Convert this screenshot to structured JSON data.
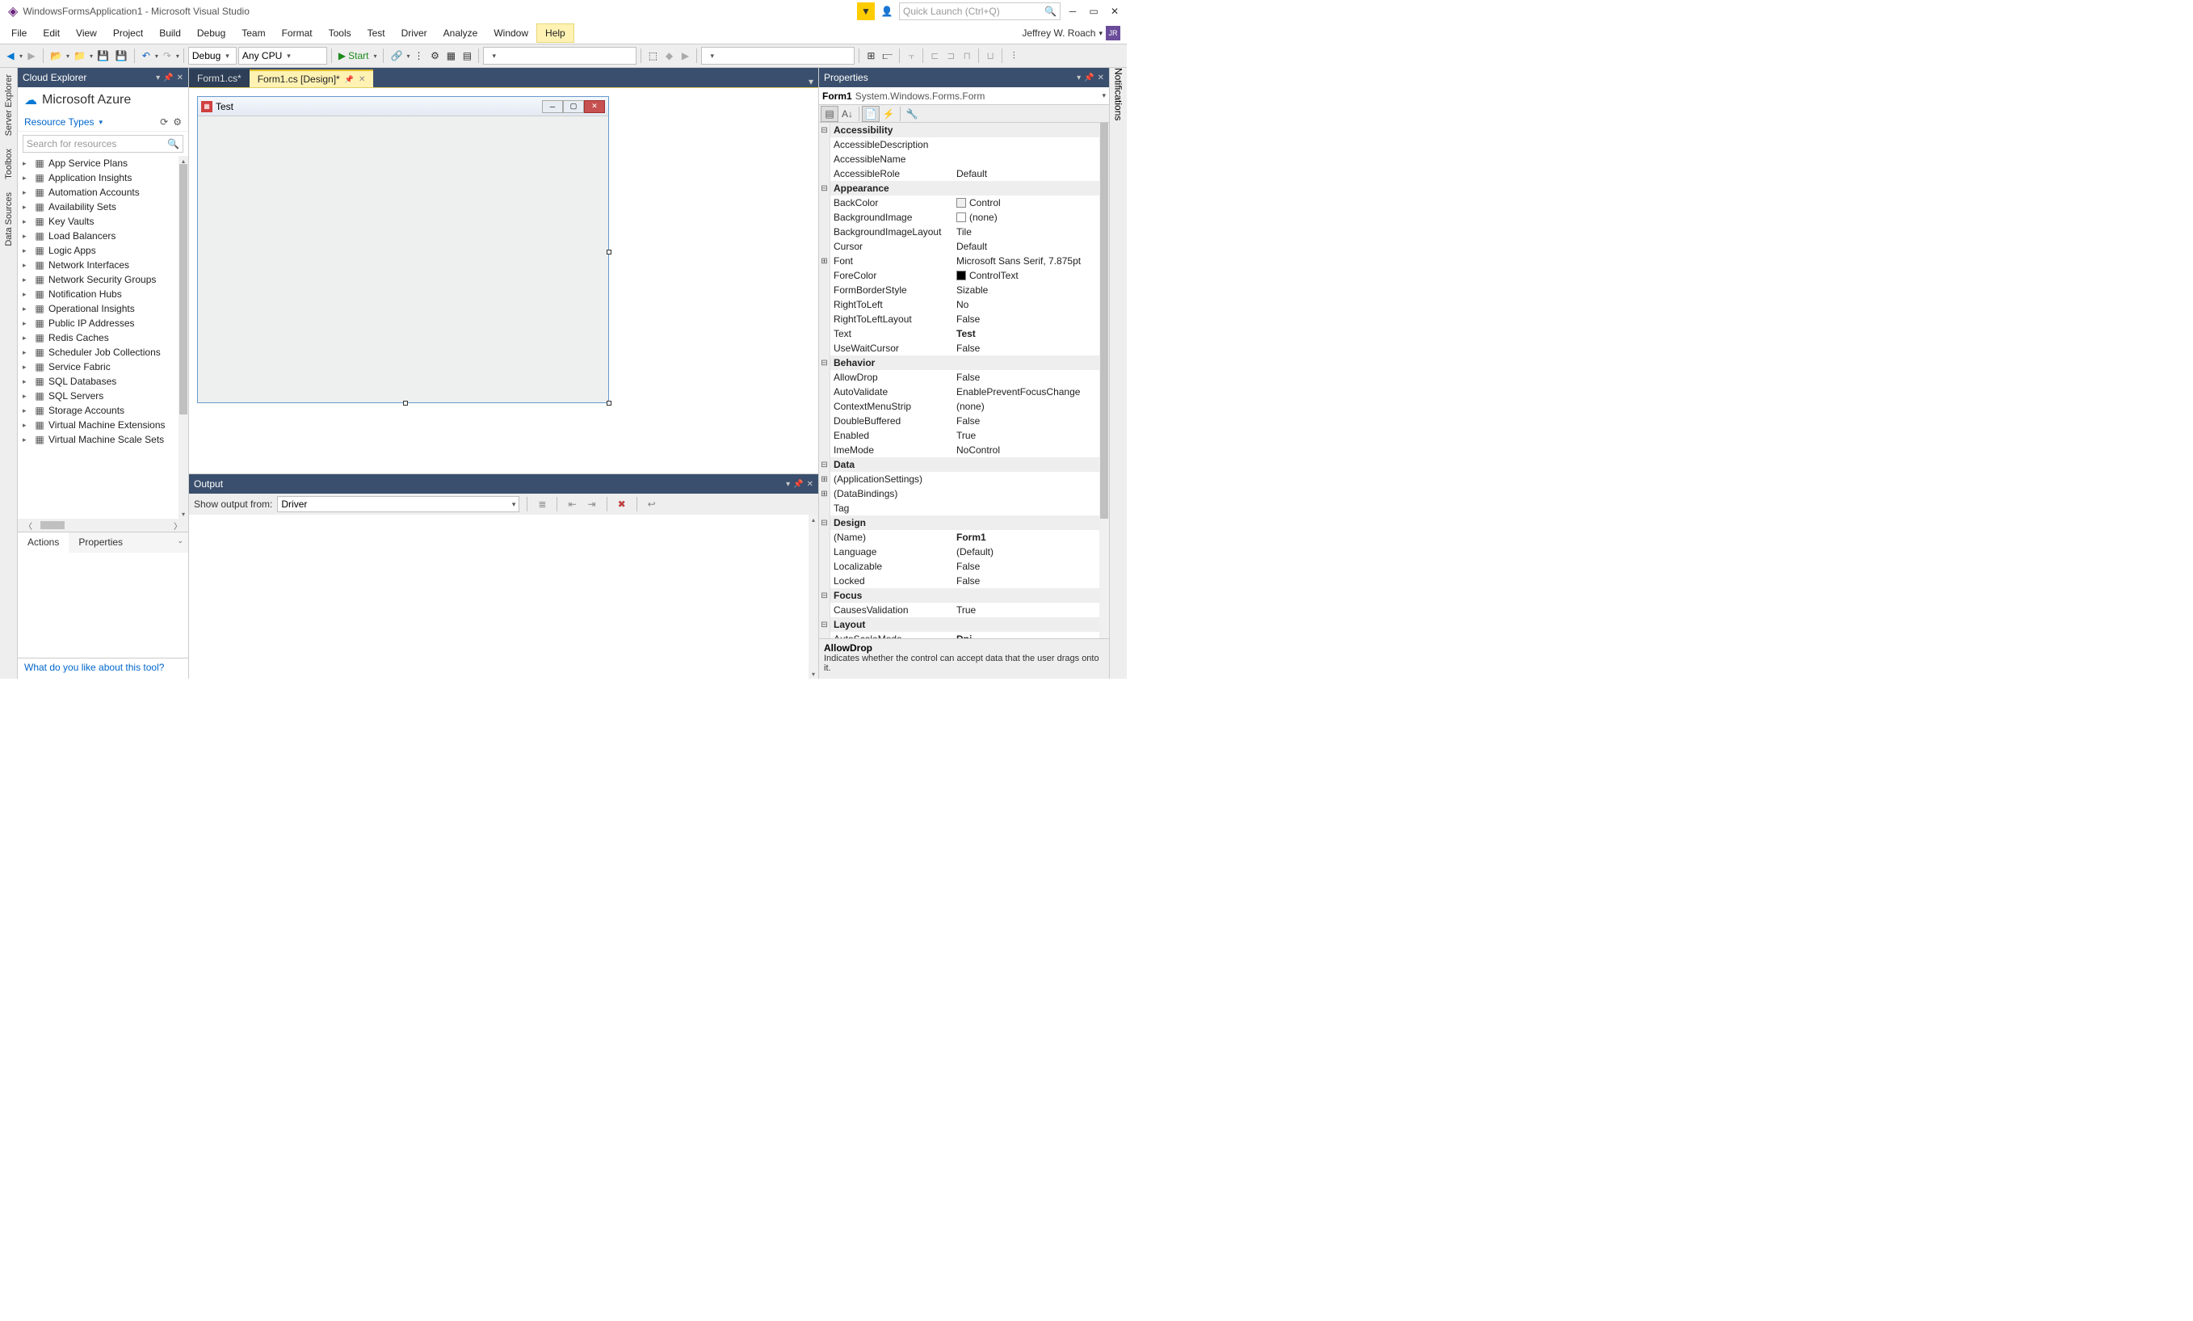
{
  "title": "WindowsFormsApplication1 - Microsoft Visual Studio",
  "quickLaunch": "Quick Launch (Ctrl+Q)",
  "menu": [
    "File",
    "Edit",
    "View",
    "Project",
    "Build",
    "Debug",
    "Team",
    "Format",
    "Tools",
    "Test",
    "Driver",
    "Analyze",
    "Window",
    "Help"
  ],
  "user": {
    "name": "Jeffrey W. Roach",
    "initials": "JR"
  },
  "toolbar": {
    "config": "Debug",
    "platform": "Any CPU",
    "start": "Start"
  },
  "cloud": {
    "title": "Cloud Explorer",
    "brand": "Microsoft Azure",
    "resTypes": "Resource Types",
    "search": "Search for resources",
    "items": [
      "App Service Plans",
      "Application Insights",
      "Automation Accounts",
      "Availability Sets",
      "Key Vaults",
      "Load Balancers",
      "Logic Apps",
      "Network Interfaces",
      "Network Security Groups",
      "Notification Hubs",
      "Operational Insights",
      "Public IP Addresses",
      "Redis Caches",
      "Scheduler Job Collections",
      "Service Fabric",
      "SQL Databases",
      "SQL Servers",
      "Storage Accounts",
      "Virtual Machine Extensions",
      "Virtual Machine Scale Sets"
    ],
    "tabs": {
      "actions": "Actions",
      "properties": "Properties"
    },
    "feedback": "What do you like about this tool?"
  },
  "leftRail": [
    "Server Explorer",
    "Toolbox",
    "Data Sources"
  ],
  "rightRail": [
    "Notifications"
  ],
  "docTabs": [
    {
      "label": "Form1.cs*"
    },
    {
      "label": "Form1.cs [Design]*"
    }
  ],
  "form": {
    "title": "Test"
  },
  "output": {
    "title": "Output",
    "showFrom": "Show output from:",
    "source": "Driver"
  },
  "props": {
    "title": "Properties",
    "objName": "Form1",
    "objType": "System.Windows.Forms.Form",
    "desc": {
      "name": "AllowDrop",
      "text": "Indicates whether the control can accept data that the user drags onto it."
    },
    "cats": [
      {
        "name": "Accessibility",
        "rows": [
          {
            "k": "AccessibleDescription",
            "v": ""
          },
          {
            "k": "AccessibleName",
            "v": ""
          },
          {
            "k": "AccessibleRole",
            "v": "Default"
          }
        ]
      },
      {
        "name": "Appearance",
        "rows": [
          {
            "k": "BackColor",
            "v": "Control",
            "swatch": "#f0f0f0"
          },
          {
            "k": "BackgroundImage",
            "v": "(none)",
            "swatch": "#ffffff"
          },
          {
            "k": "BackgroundImageLayout",
            "v": "Tile"
          },
          {
            "k": "Cursor",
            "v": "Default"
          },
          {
            "k": "Font",
            "v": "Microsoft Sans Serif, 7.875pt",
            "exp": "+"
          },
          {
            "k": "ForeColor",
            "v": "ControlText",
            "swatch": "#000000"
          },
          {
            "k": "FormBorderStyle",
            "v": "Sizable"
          },
          {
            "k": "RightToLeft",
            "v": "No"
          },
          {
            "k": "RightToLeftLayout",
            "v": "False"
          },
          {
            "k": "Text",
            "v": "Test",
            "bold": true
          },
          {
            "k": "UseWaitCursor",
            "v": "False"
          }
        ]
      },
      {
        "name": "Behavior",
        "rows": [
          {
            "k": "AllowDrop",
            "v": "False"
          },
          {
            "k": "AutoValidate",
            "v": "EnablePreventFocusChange"
          },
          {
            "k": "ContextMenuStrip",
            "v": "(none)"
          },
          {
            "k": "DoubleBuffered",
            "v": "False"
          },
          {
            "k": "Enabled",
            "v": "True"
          },
          {
            "k": "ImeMode",
            "v": "NoControl"
          }
        ]
      },
      {
        "name": "Data",
        "rows": [
          {
            "k": "(ApplicationSettings)",
            "v": "",
            "exp": "+"
          },
          {
            "k": "(DataBindings)",
            "v": "",
            "exp": "+"
          },
          {
            "k": "Tag",
            "v": ""
          }
        ]
      },
      {
        "name": "Design",
        "rows": [
          {
            "k": "(Name)",
            "v": "Form1",
            "bold": true
          },
          {
            "k": "Language",
            "v": "(Default)"
          },
          {
            "k": "Localizable",
            "v": "False"
          },
          {
            "k": "Locked",
            "v": "False"
          }
        ]
      },
      {
        "name": "Focus",
        "rows": [
          {
            "k": "CausesValidation",
            "v": "True"
          }
        ]
      },
      {
        "name": "Layout",
        "rows": [
          {
            "k": "AutoScaleMode",
            "v": "Dpi",
            "bold": true
          }
        ]
      }
    ]
  }
}
